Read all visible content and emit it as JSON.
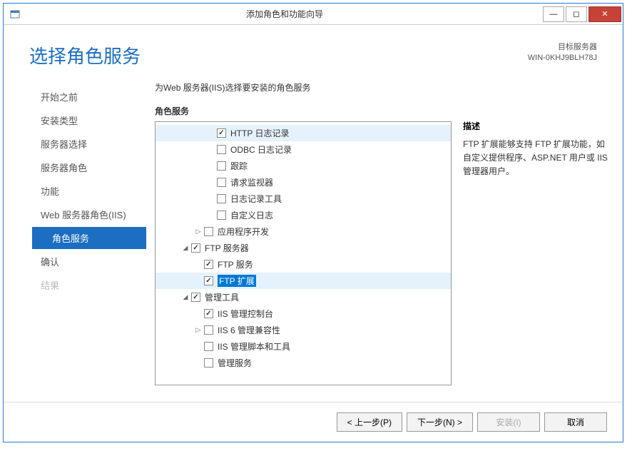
{
  "window": {
    "title": "添加角色和功能向导"
  },
  "heading": "选择角色服务",
  "server": {
    "target_label": "目标服务器",
    "target_name": "WIN-0KHJ9BLH78J"
  },
  "sidebar": {
    "items": [
      {
        "label": "开始之前",
        "selected": false
      },
      {
        "label": "安装类型",
        "selected": false
      },
      {
        "label": "服务器选择",
        "selected": false
      },
      {
        "label": "服务器角色",
        "selected": false
      },
      {
        "label": "功能",
        "selected": false
      },
      {
        "label": "Web 服务器角色(IIS)",
        "selected": false
      },
      {
        "label": "角色服务",
        "selected": true,
        "sub": true
      },
      {
        "label": "确认",
        "selected": false
      },
      {
        "label": "结果",
        "selected": false,
        "disabled": true
      }
    ]
  },
  "instruction": "为Web 服务器(IIS)选择要安装的角色服务",
  "section_label": "角色服务",
  "tree": [
    {
      "indent": 4,
      "checked": true,
      "label": "HTTP 日志记录",
      "highlighted": true
    },
    {
      "indent": 4,
      "checked": false,
      "label": "ODBC 日志记录"
    },
    {
      "indent": 4,
      "checked": false,
      "label": "跟踪"
    },
    {
      "indent": 4,
      "checked": false,
      "label": "请求监视器"
    },
    {
      "indent": 4,
      "checked": false,
      "label": "日志记录工具"
    },
    {
      "indent": 4,
      "checked": false,
      "label": "自定义日志"
    },
    {
      "indent": 3,
      "expander": "▷",
      "checked": false,
      "label": "应用程序开发"
    },
    {
      "indent": 2,
      "expander": "◢",
      "checked": true,
      "label": "FTP 服务器"
    },
    {
      "indent": 3,
      "checked": true,
      "label": "FTP 服务"
    },
    {
      "indent": 3,
      "checked": true,
      "label": "FTP 扩展",
      "highlighted": true,
      "label_selected": true
    },
    {
      "indent": 2,
      "expander": "◢",
      "checked": true,
      "label": "管理工具"
    },
    {
      "indent": 3,
      "checked": true,
      "label": "IIS 管理控制台"
    },
    {
      "indent": 3,
      "expander": "▷",
      "checked": false,
      "label": "IIS 6 管理兼容性"
    },
    {
      "indent": 3,
      "checked": false,
      "label": "IIS 管理脚本和工具"
    },
    {
      "indent": 3,
      "checked": false,
      "label": "管理服务"
    }
  ],
  "description": {
    "title": "描述",
    "text": "FTP 扩展能够支持 FTP 扩展功能，如自定义提供程序、ASP.NET 用户或 IIS 管理器用户。"
  },
  "buttons": {
    "prev": "< 上一步(P)",
    "next": "下一步(N) >",
    "install": "安装(I)",
    "cancel": "取消"
  }
}
